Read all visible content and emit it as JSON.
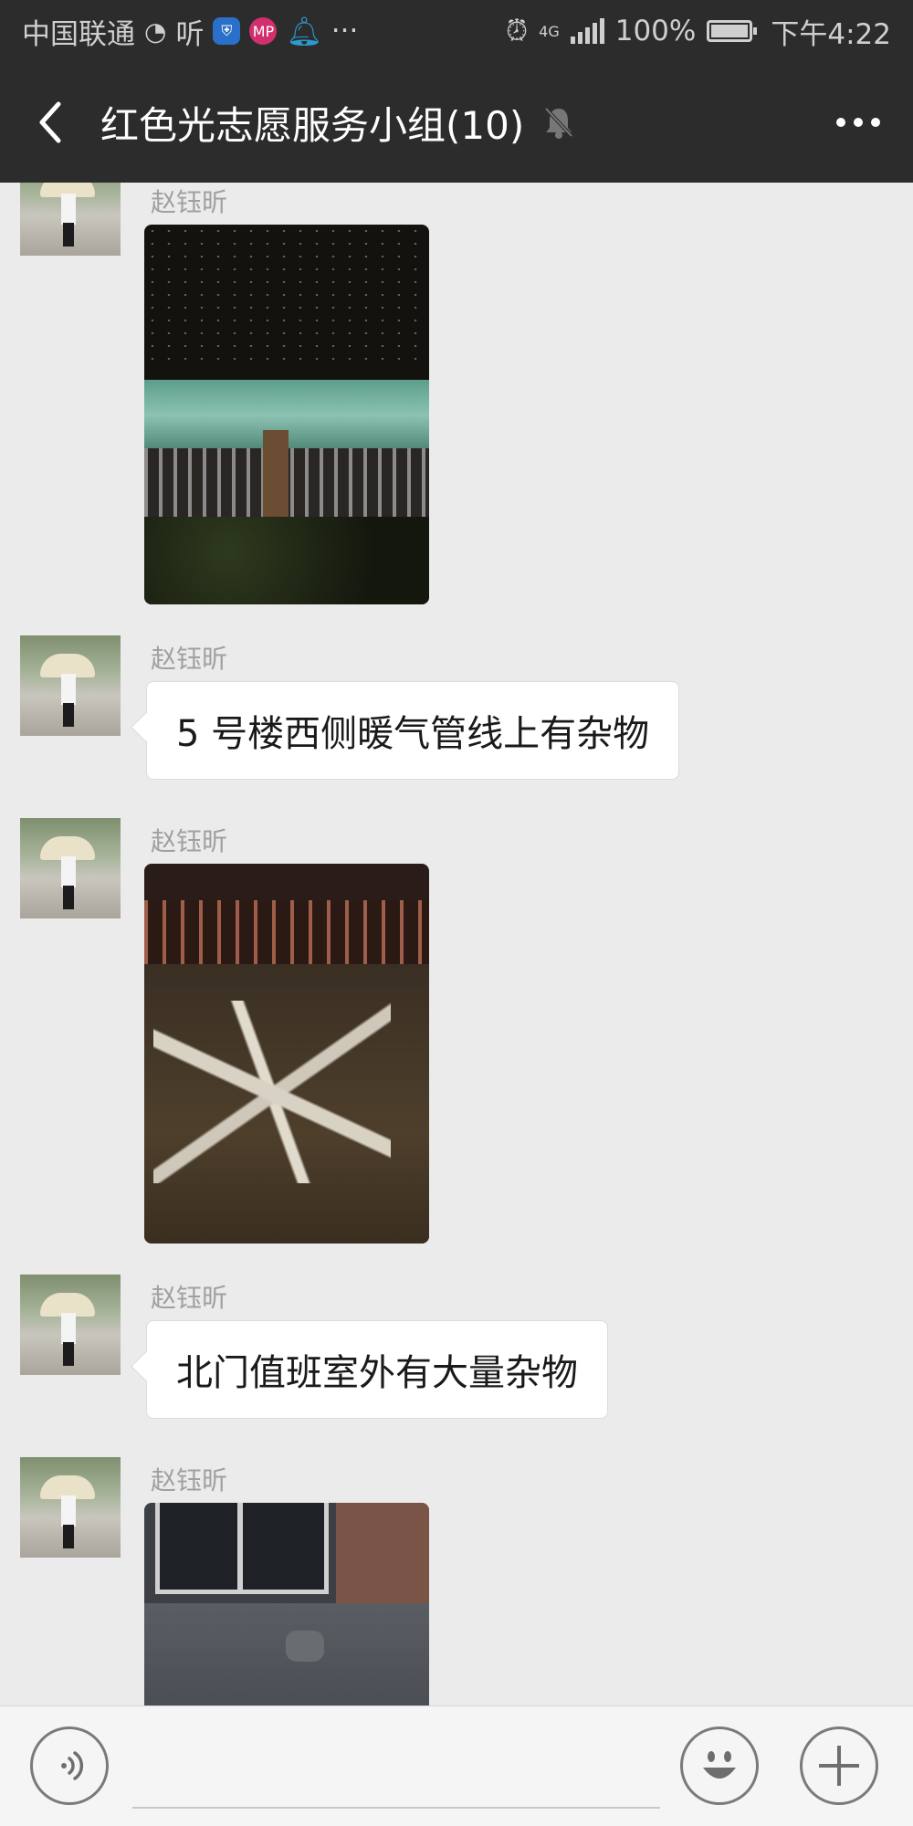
{
  "status_bar": {
    "carrier": "中国联通",
    "listen_label": "听",
    "mp_label": "MP",
    "more_label": "···",
    "network_label": "4G",
    "battery": "100%",
    "time": "下午4:22"
  },
  "header": {
    "title": "红色光志愿服务小组(10)",
    "muted": true
  },
  "messages": [
    {
      "sender": "赵钰昕",
      "type": "image"
    },
    {
      "sender": "赵钰昕",
      "type": "text",
      "text": "5 号楼西侧暖气管线上有杂物"
    },
    {
      "sender": "赵钰昕",
      "type": "image"
    },
    {
      "sender": "赵钰昕",
      "type": "text",
      "text": "北门值班室外有大量杂物"
    },
    {
      "sender": "赵钰昕",
      "type": "image"
    }
  ],
  "input_bar": {
    "message_value": ""
  },
  "colors": {
    "header_bg": "#2c2c2c",
    "chat_bg": "#ebebeb",
    "bubble_bg": "#ffffff",
    "sender_text": "#a0a0a0",
    "input_bg": "#f5f5f6"
  }
}
